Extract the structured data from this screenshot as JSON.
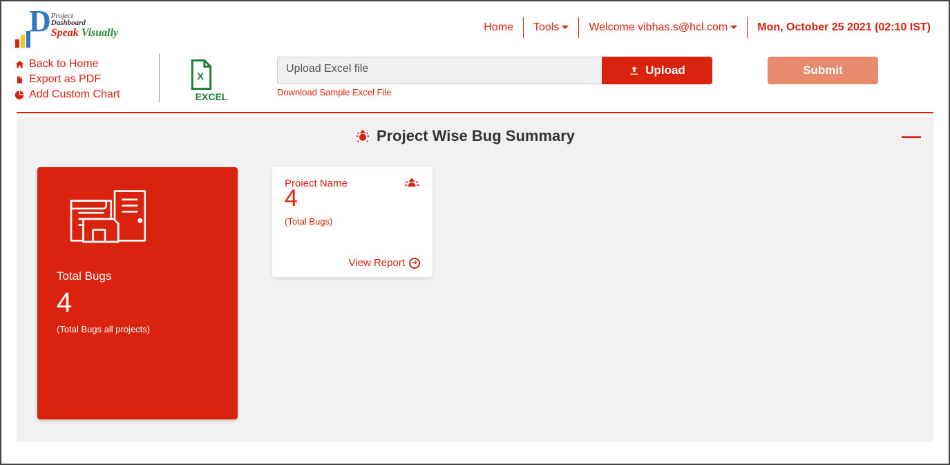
{
  "header": {
    "logo": {
      "line1": "Project",
      "line2": "Dashboard",
      "speak1": "Speak",
      "speak2": " Visually"
    },
    "nav": {
      "home": "Home",
      "tools": "Tools",
      "welcome": "Welcome vibhas.s@hcl.com",
      "datetime": "Mon, October 25 2021 (02:10 IST)"
    }
  },
  "sidebar": {
    "back": "Back to Home",
    "export": "Export as PDF",
    "add_chart": "Add Custom Chart"
  },
  "upload": {
    "excel_label": "EXCEL",
    "placeholder": "Upload Excel file",
    "upload_btn": "Upload",
    "sample_link": "Download Sample Excel File",
    "submit_btn": "Submit"
  },
  "dashboard": {
    "title": "Project Wise Bug Summary",
    "total_card": {
      "title": "Total Bugs",
      "value": "4",
      "sub": "(Total Bugs all projects)"
    },
    "project_card": {
      "name_label": "Project Name",
      "value": "4",
      "sub": "(Total Bugs)",
      "view": "View Report"
    }
  }
}
